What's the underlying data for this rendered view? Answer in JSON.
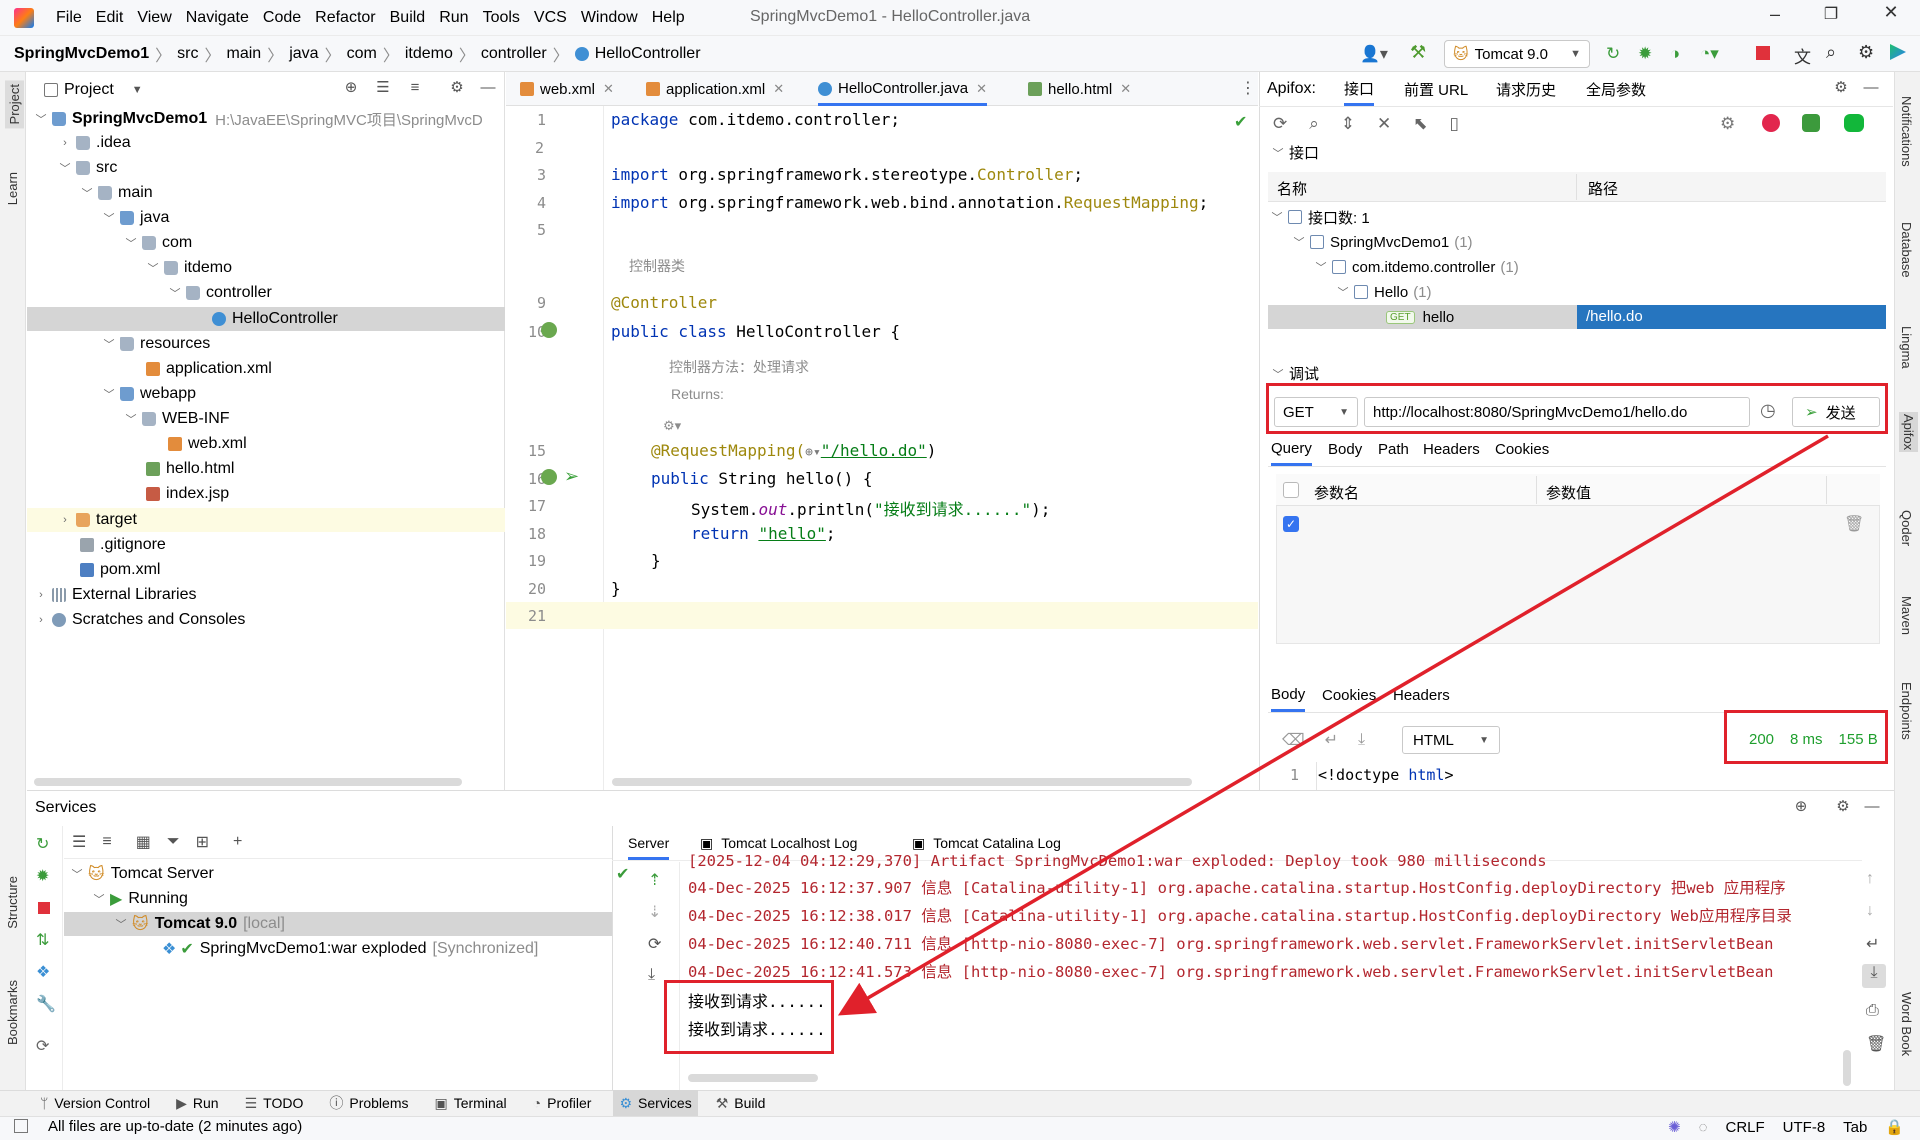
{
  "menu": [
    "File",
    "Edit",
    "View",
    "Navigate",
    "Code",
    "Refactor",
    "Build",
    "Run",
    "Tools",
    "VCS",
    "Window",
    "Help"
  ],
  "window_title": "SpringMvcDemo1 - HelloController.java",
  "breadcrumb": [
    "SpringMvcDemo1",
    "src",
    "main",
    "java",
    "com",
    "itdemo",
    "controller",
    "HelloController"
  ],
  "run_config": "Tomcat 9.0",
  "project_panel": {
    "title": "Project",
    "root_name": "SpringMvcDemo1",
    "root_path": "H:\\JavaEE\\SpringMVC项目\\SpringMvcD",
    "items": [
      ".idea",
      "src",
      "main",
      "java",
      "com",
      "itdemo",
      "controller",
      "HelloController",
      "resources",
      "application.xml",
      "webapp",
      "WEB-INF",
      "web.xml",
      "hello.html",
      "index.jsp",
      "target",
      ".gitignore",
      "pom.xml",
      "External Libraries",
      "Scratches and Consoles"
    ]
  },
  "editor": {
    "tabs": [
      "web.xml",
      "application.xml",
      "HelloController.java",
      "hello.html"
    ],
    "line_numbers": [
      "1",
      "2",
      "3",
      "4",
      "5",
      "9",
      "10",
      "15",
      "16",
      "17",
      "18",
      "19",
      "20",
      "21"
    ],
    "code": {
      "l1_kw": "package",
      "l1_rest": " com.itdemo.controller;",
      "l3_kw": "import",
      "l3_rest": " org.springframework.stereotype.",
      "l3_cls": "Controller",
      "l3_end": ";",
      "l4_kw": "import",
      "l4_rest": " org.springframework.web.bind.annotation.",
      "l4_cls": "RequestMapping",
      "l4_end": ";",
      "doc1": "控制器类",
      "l9": "@Controller",
      "l10_kw": "public class",
      "l10_rest": " HelloController {",
      "doc2a": "控制器方法：处理请求",
      "doc2b": "Returns:",
      "l15_ann": "@RequestMapping(",
      "l15_str": "\"/hello.do\"",
      "l15_end": ")",
      "l16_kw": "public",
      "l16_rest": " String hello() {",
      "l17_a": "System.",
      "l17_out": "out",
      "l17_b": ".println(",
      "l17_str": "\"接收到请求......\"",
      "l17_end": ");",
      "l18_kw": "return",
      "l18_str": "\"hello\"",
      "l18_end": ";",
      "l19": "}",
      "l20": "}"
    }
  },
  "apifox": {
    "label": "Apifox:",
    "tabs": [
      "接口",
      "前置 URL",
      "请求历史",
      "全局参数"
    ],
    "section_api": "接口",
    "col_name": "名称",
    "col_path": "路径",
    "tree": {
      "count": "接口数: 1",
      "project": "SpringMvcDemo1",
      "project_count": "(1)",
      "package": "com.itdemo.controller",
      "package_count": "(1)",
      "group": "Hello",
      "group_count": "(1)",
      "method_badge": "GET",
      "api": "hello",
      "api_path": "/hello.do"
    },
    "section_debug": "调试",
    "method": "GET",
    "url": "http://localhost:8080/SpringMvcDemo1/hello.do",
    "send": "发送",
    "req_tabs": [
      "Query",
      "Body",
      "Path",
      "Headers",
      "Cookies"
    ],
    "param_name": "参数名",
    "param_value": "参数值",
    "resp_tabs": [
      "Body",
      "Cookies",
      "Headers"
    ],
    "format": "HTML",
    "status": "200",
    "time": "8 ms",
    "size": "155 B",
    "resp_line_no": "1",
    "resp_line_a": "<!doctype ",
    "resp_line_b": "html",
    "resp_line_c": ">"
  },
  "services": {
    "title": "Services",
    "tree": {
      "server": "Tomcat Server",
      "running": "Running",
      "tomcat": "Tomcat 9.0",
      "tomcat_tag": "[local]",
      "artifact": "SpringMvcDemo1:war exploded",
      "artifact_tag": "[Synchronized]"
    },
    "tabs": [
      "Server",
      "Tomcat Localhost Log",
      "Tomcat Catalina Log"
    ],
    "log_partial": "[2025-12-04 04:12:29,370] Artifact SpringMvcDemo1:war exploded: Deploy took 980 milliseconds",
    "logs": [
      "04-Dec-2025 16:12:37.907 信息 [Catalina-utility-1] org.apache.catalina.startup.HostConfig.deployDirectory 把web 应用程序",
      "04-Dec-2025 16:12:38.017 信息 [Catalina-utility-1] org.apache.catalina.startup.HostConfig.deployDirectory Web应用程序目录",
      "04-Dec-2025 16:12:40.711 信息 [http-nio-8080-exec-7] org.springframework.web.servlet.FrameworkServlet.initServletBean",
      "04-Dec-2025 16:12:41.573 信息 [http-nio-8080-exec-7] org.springframework.web.servlet.FrameworkServlet.initServletBean"
    ],
    "output": [
      "接收到请求......",
      "接收到请求......"
    ]
  },
  "bottom_tabs": [
    "Version Control",
    "Run",
    "TODO",
    "Problems",
    "Terminal",
    "Profiler",
    "Services",
    "Build"
  ],
  "status_bar": {
    "message": "All files are up-to-date (2 minutes ago)",
    "line_sep": "CRLF",
    "encoding": "UTF-8",
    "indent": "Tab"
  },
  "left_strip": [
    "Project",
    "Learn",
    "Structure",
    "Bookmarks"
  ],
  "right_strip": [
    "Notifications",
    "Database",
    "Lingma",
    "Apifox",
    "Qoder",
    "Maven",
    "Endpoints",
    "Word Book"
  ],
  "colors": {
    "accent": "#2675bf",
    "red_annotation": "#e0212b",
    "selection": "#d5d5d5",
    "api_selected": "#2675bf",
    "status_green": "#1f9f2e"
  }
}
